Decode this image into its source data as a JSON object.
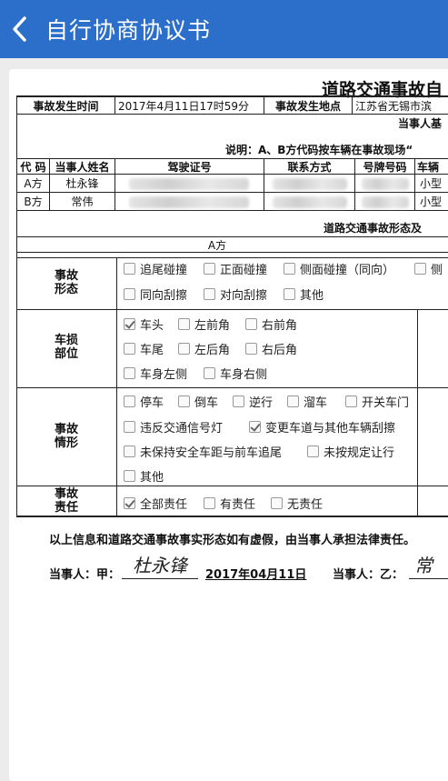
{
  "header": {
    "title": "自行协商协议书"
  },
  "doc": {
    "title": "道路交通事故自",
    "row1": {
      "time_label": "事故发生时间",
      "time_value": "2017年4月11日17时59分",
      "place_label": "事故发生地点",
      "place_value": "江苏省无锡市滨"
    },
    "party_header": "当事人基",
    "note": "说明：A、B方代码按车辆在事故现场“",
    "columns": {
      "code": "代 码",
      "name": "当事人姓名",
      "license": "驾驶证号",
      "contact": "联系方式",
      "plate": "号牌号码",
      "vehicle": "车辆"
    },
    "parties": [
      {
        "code": "A方",
        "name": "杜永锋",
        "vehicle": "小型"
      },
      {
        "code": "B方",
        "name": "常伟",
        "vehicle": "小型"
      }
    ],
    "section_header": "道路交通事故形态及",
    "side_a": "A方",
    "form": {
      "label": "事故\n形态",
      "options": [
        "追尾碰撞",
        "正面碰撞",
        "侧面碰撞（同向）",
        "侧",
        "同向刮擦",
        "对向刮擦",
        "其他"
      ]
    },
    "damage": {
      "label": "车损\n部位",
      "options": [
        "车头",
        "左前角",
        "右前角",
        "车尾",
        "左后角",
        "右后角",
        "车身左侧",
        "车身右侧"
      ]
    },
    "situation": {
      "label": "事故\n情形",
      "options": [
        "停车",
        "倒车",
        "逆行",
        "溜车",
        "开关车门",
        "违反交通信号灯",
        "变更车道与其他车辆刮擦",
        "未保持安全车距与前车追尾",
        "未按规定让行",
        "其他"
      ]
    },
    "liability": {
      "label": "事故\n责任",
      "options": [
        "全部责任",
        "有责任",
        "无责任"
      ]
    },
    "declaration": "以上信息和道路交通事故事实形态如有虚假，由当事人承担法律责任。",
    "sign_a_label": "当事人：甲：",
    "sign_a_name": "杜永锋",
    "sign_date": "2017年04月11日",
    "sign_b_label": "当事人：乙：",
    "sign_b_name": "常"
  }
}
